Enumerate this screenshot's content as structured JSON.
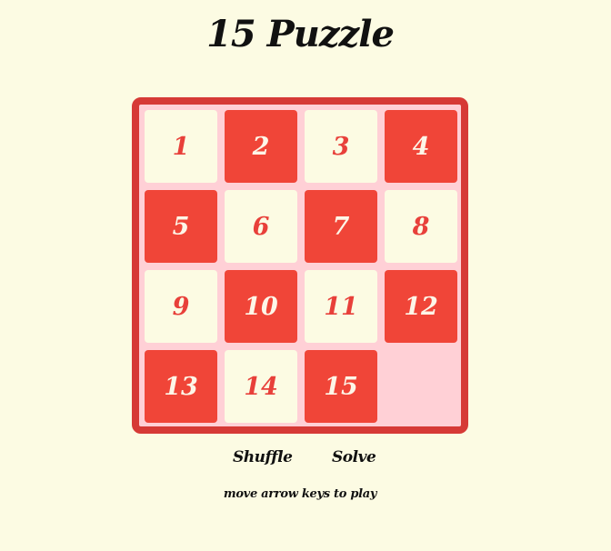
{
  "game": {
    "title": "15 Puzzle",
    "tiles": [
      "1",
      "2",
      "3",
      "4",
      "5",
      "6",
      "7",
      "8",
      "9",
      "10",
      "11",
      "12",
      "13",
      "14",
      "15",
      ""
    ],
    "controls": {
      "shuffle_label": "Shuffle",
      "solve_label": "Solve"
    },
    "hint": "move arrow keys to play"
  },
  "colors": {
    "background": "#fcfbe3",
    "board_frame": "#d63a36",
    "board_fill": "#ffd0d6",
    "tile_dark": "#f04538",
    "tile_light": "#fcfbe3",
    "tile_dark_text": "#fdf6e8",
    "tile_light_text": "#e8403a",
    "text": "#111111"
  }
}
